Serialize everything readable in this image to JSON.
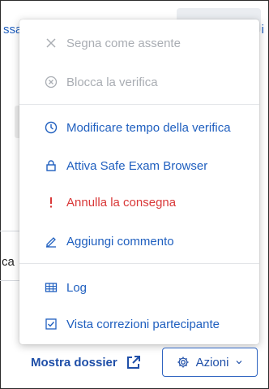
{
  "menu": {
    "items": [
      {
        "label": "Segna come assente",
        "icon": "close-icon"
      },
      {
        "label": "Blocca la verifica",
        "icon": "circle-x-icon"
      },
      {
        "label": "Modificare tempo della verifica",
        "icon": "clock-icon"
      },
      {
        "label": "Attiva Safe Exam Browser",
        "icon": "lock-icon"
      },
      {
        "label": "Annulla la consegna",
        "icon": "exclamation-icon"
      },
      {
        "label": "Aggiungi commento",
        "icon": "pencil-icon"
      },
      {
        "label": "Log",
        "icon": "table-icon"
      },
      {
        "label": "Vista correzioni partecipante",
        "icon": "checkbox-icon"
      }
    ]
  },
  "background": {
    "cut_left": "ssa",
    "cut_right": "i",
    "cut_mid": "ca"
  },
  "footer": {
    "dossier_label": "Mostra dossier",
    "actions_label": "Azioni"
  },
  "colors": {
    "link_blue": "#1f5fbf",
    "disabled_gray": "#a9adb3",
    "danger_red": "#d93838"
  }
}
